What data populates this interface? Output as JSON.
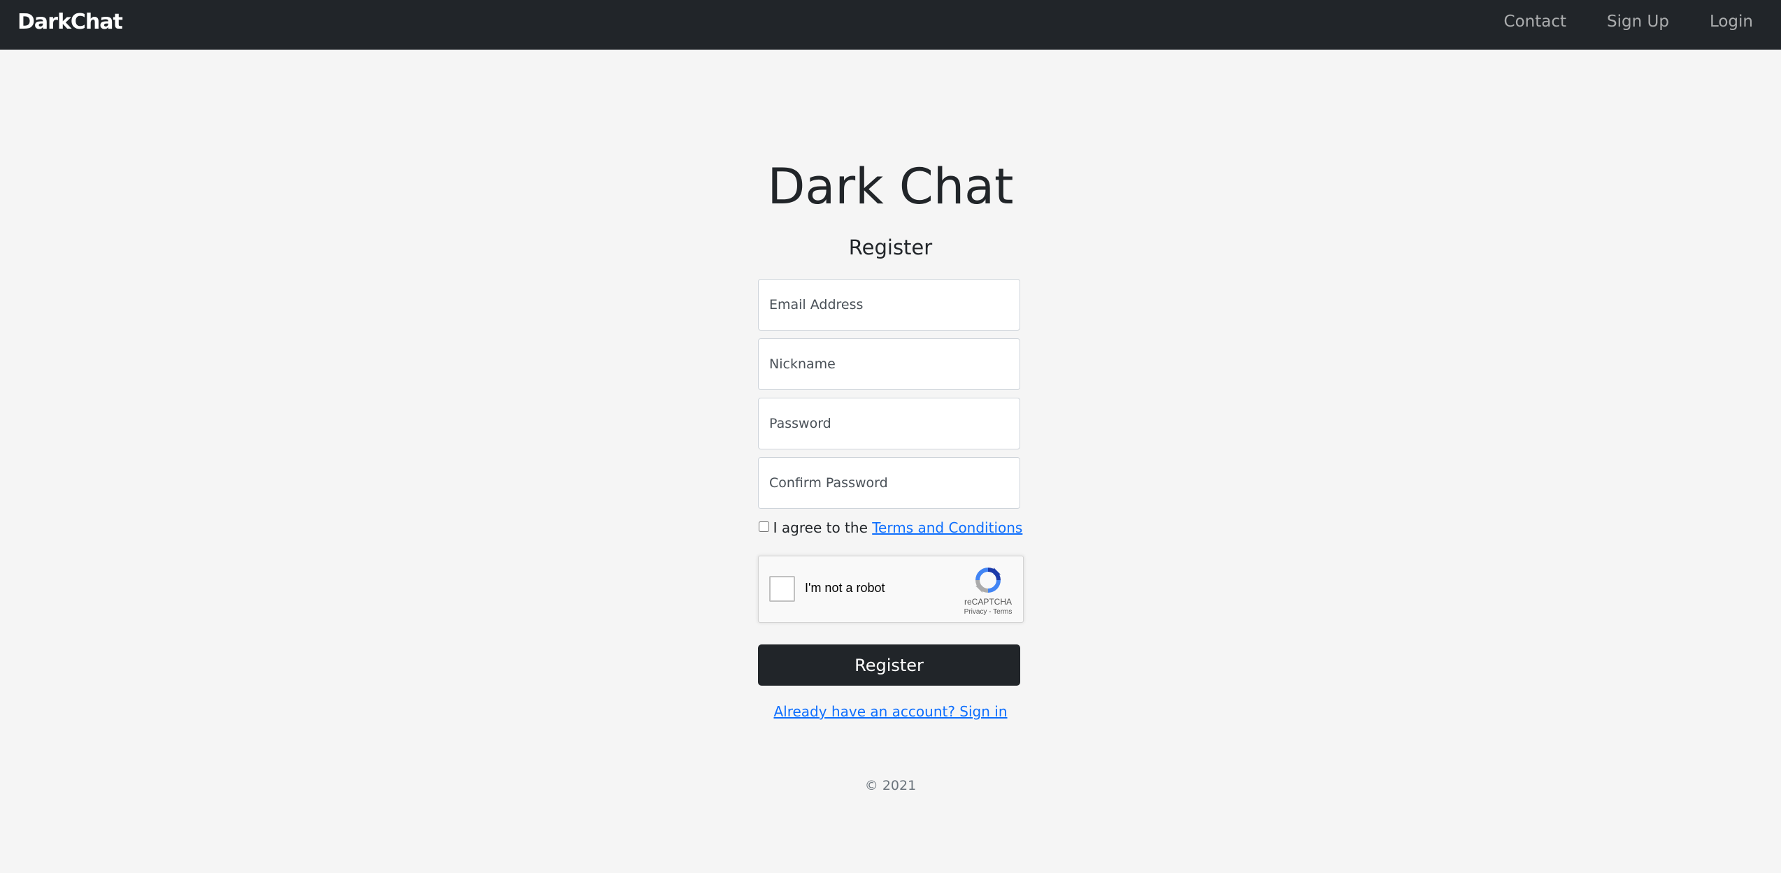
{
  "navbar": {
    "brand": "DarkChat",
    "links": [
      "Contact",
      "Sign Up",
      "Login"
    ],
    "background": "#212529"
  },
  "page": {
    "title": "Dark Chat",
    "subtitle": "Register"
  },
  "form": {
    "email_placeholder": "Email Address",
    "nickname_placeholder": "Nickname",
    "password_placeholder": "Password",
    "confirm_password_placeholder": "Confirm Password",
    "terms_prefix": "I agree to the ",
    "terms_link": "Terms and Conditions",
    "terms_checked": false,
    "submit_label": "Register",
    "signin_link": "Already have an account? Sign in"
  },
  "recaptcha": {
    "label": "I'm not a robot",
    "brand": "reCAPTCHA",
    "privacy": "Privacy",
    "separator": " - ",
    "terms": "Terms",
    "checked": false,
    "icon": "recaptcha-logo"
  },
  "footer": {
    "copyright": "© 2021"
  },
  "colors": {
    "accent_link": "#0d6efd",
    "button": "#212529",
    "background": "#f5f5f5"
  }
}
